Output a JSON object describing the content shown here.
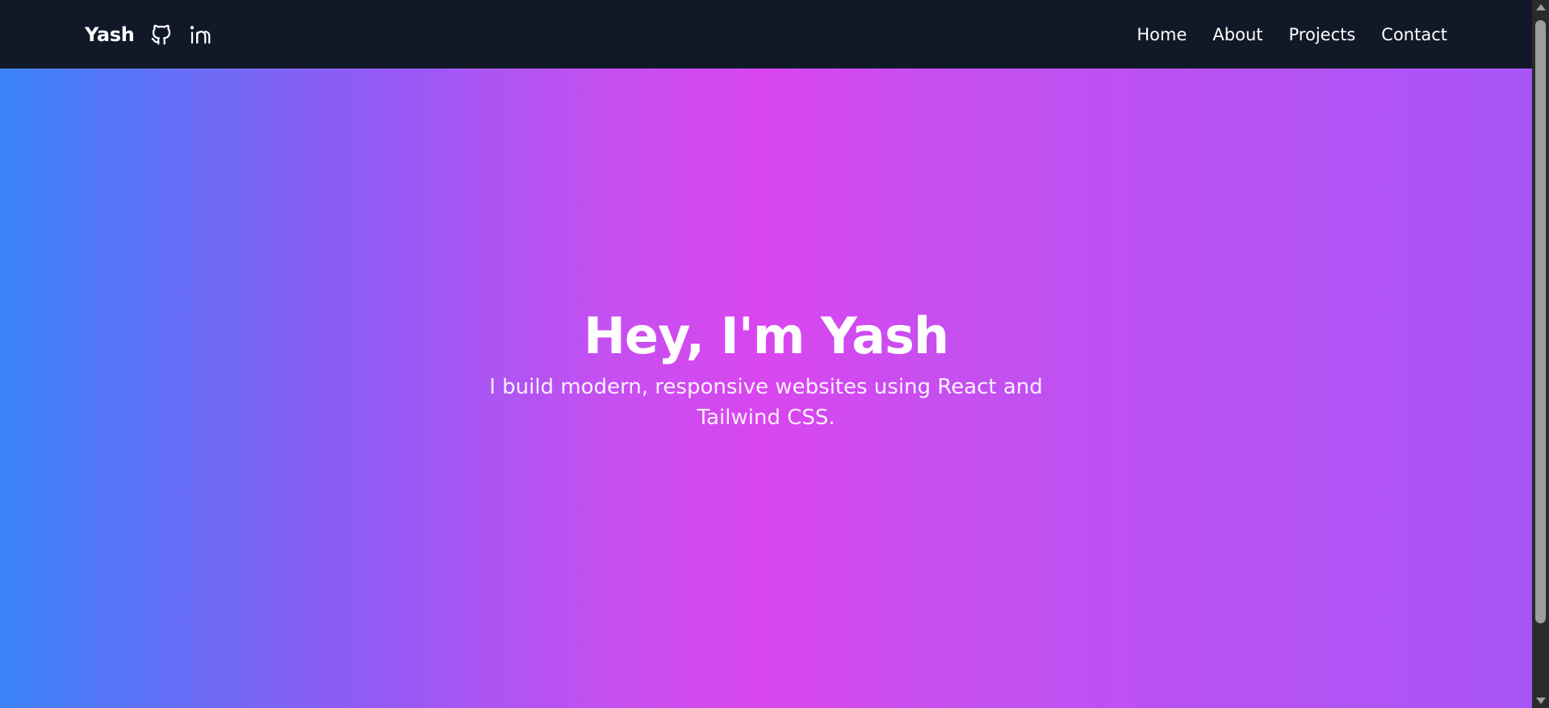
{
  "nav": {
    "brand": "Yash",
    "social": [
      {
        "icon": "github-icon"
      },
      {
        "icon": "linkedin-icon"
      }
    ],
    "links": [
      "Home",
      "About",
      "Projects",
      "Contact"
    ]
  },
  "hero": {
    "title": "Hey, I'm Yash",
    "subtitle": "I build modern, responsive websites using React and Tailwind CSS."
  },
  "colors": {
    "navbar_bg": "#111827",
    "gradient_start": "#3b82f6",
    "gradient_mid": "#d946ef",
    "gradient_end": "#a855f7",
    "text": "#ffffff"
  }
}
